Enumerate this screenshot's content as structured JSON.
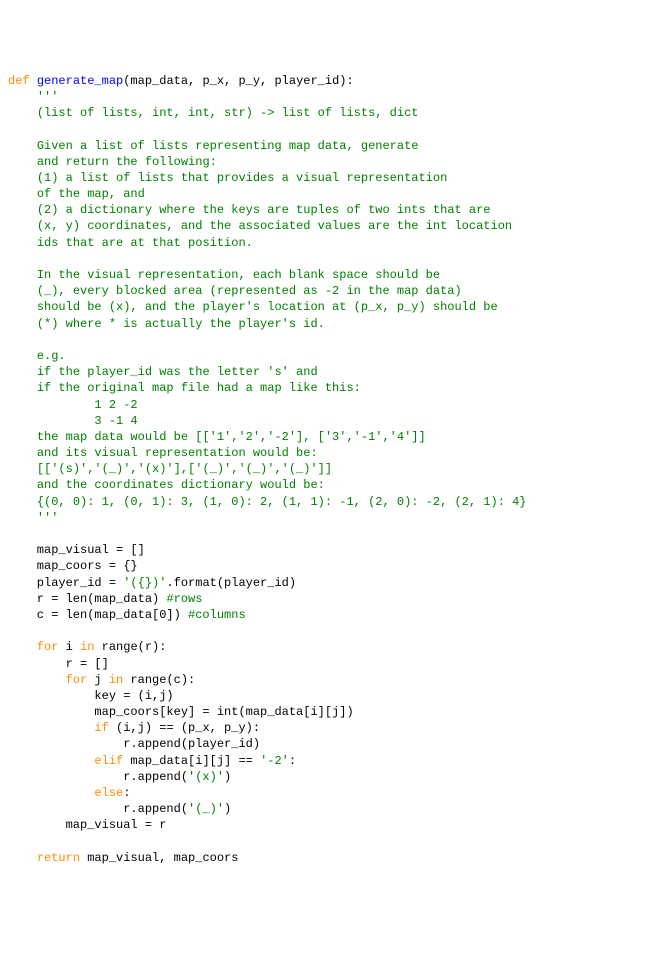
{
  "code": {
    "lines": [
      {
        "parts": [
          {
            "cls": "kw",
            "t": "def "
          },
          {
            "cls": "fn",
            "t": "generate_map"
          },
          {
            "cls": "",
            "t": "(map_data, p_x, p_y, player_id):"
          }
        ]
      },
      {
        "parts": [
          {
            "cls": "",
            "t": "    "
          },
          {
            "cls": "s",
            "t": "'''"
          }
        ]
      },
      {
        "parts": [
          {
            "cls": "",
            "t": "    "
          },
          {
            "cls": "s",
            "t": "(list of lists, int, int, str) -> list of lists, dict"
          }
        ]
      },
      {
        "parts": [
          {
            "cls": "s",
            "t": ""
          }
        ]
      },
      {
        "parts": [
          {
            "cls": "",
            "t": "    "
          },
          {
            "cls": "s",
            "t": "Given a list of lists representing map data, generate"
          }
        ]
      },
      {
        "parts": [
          {
            "cls": "",
            "t": "    "
          },
          {
            "cls": "s",
            "t": "and return the following:"
          }
        ]
      },
      {
        "parts": [
          {
            "cls": "",
            "t": "    "
          },
          {
            "cls": "s",
            "t": "(1) a list of lists that provides a visual representation"
          }
        ]
      },
      {
        "parts": [
          {
            "cls": "",
            "t": "    "
          },
          {
            "cls": "s",
            "t": "of the map, and"
          }
        ]
      },
      {
        "parts": [
          {
            "cls": "",
            "t": "    "
          },
          {
            "cls": "s",
            "t": "(2) a dictionary where the keys are tuples of two ints that are"
          }
        ]
      },
      {
        "parts": [
          {
            "cls": "",
            "t": "    "
          },
          {
            "cls": "s",
            "t": "(x, y) coordinates, and the associated values are the int location"
          }
        ]
      },
      {
        "parts": [
          {
            "cls": "",
            "t": "    "
          },
          {
            "cls": "s",
            "t": "ids that are at that position."
          }
        ]
      },
      {
        "parts": [
          {
            "cls": "s",
            "t": ""
          }
        ]
      },
      {
        "parts": [
          {
            "cls": "",
            "t": "    "
          },
          {
            "cls": "s",
            "t": "In the visual representation, each blank space should be"
          }
        ]
      },
      {
        "parts": [
          {
            "cls": "",
            "t": "    "
          },
          {
            "cls": "s",
            "t": "(_), every blocked area (represented as -2 in the map data)"
          }
        ]
      },
      {
        "parts": [
          {
            "cls": "",
            "t": "    "
          },
          {
            "cls": "s",
            "t": "should be (x), and the player's location at (p_x, p_y) should be"
          }
        ]
      },
      {
        "parts": [
          {
            "cls": "",
            "t": "    "
          },
          {
            "cls": "s",
            "t": "(*) where * is actually the player's id."
          }
        ]
      },
      {
        "parts": [
          {
            "cls": "s",
            "t": ""
          }
        ]
      },
      {
        "parts": [
          {
            "cls": "",
            "t": "    "
          },
          {
            "cls": "s",
            "t": "e.g."
          }
        ]
      },
      {
        "parts": [
          {
            "cls": "",
            "t": "    "
          },
          {
            "cls": "s",
            "t": "if the player_id was the letter 's' and"
          }
        ]
      },
      {
        "parts": [
          {
            "cls": "",
            "t": "    "
          },
          {
            "cls": "s",
            "t": "if the original map file had a map like this:"
          }
        ]
      },
      {
        "parts": [
          {
            "cls": "",
            "t": "    "
          },
          {
            "cls": "s",
            "t": "        1 2 -2"
          }
        ]
      },
      {
        "parts": [
          {
            "cls": "",
            "t": "    "
          },
          {
            "cls": "s",
            "t": "        3 -1 4"
          }
        ]
      },
      {
        "parts": [
          {
            "cls": "",
            "t": "    "
          },
          {
            "cls": "s",
            "t": "the map data would be [['1','2','-2'], ['3','-1','4']]"
          }
        ]
      },
      {
        "parts": [
          {
            "cls": "",
            "t": "    "
          },
          {
            "cls": "s",
            "t": "and its visual representation would be:"
          }
        ]
      },
      {
        "parts": [
          {
            "cls": "",
            "t": "    "
          },
          {
            "cls": "s",
            "t": "[['(s)','(_)','(x)'],['(_)','(_)','(_)']]"
          }
        ]
      },
      {
        "parts": [
          {
            "cls": "",
            "t": "    "
          },
          {
            "cls": "s",
            "t": "and the coordinates dictionary would be:"
          }
        ]
      },
      {
        "parts": [
          {
            "cls": "",
            "t": "    "
          },
          {
            "cls": "s",
            "t": "{(0, 0): 1, (0, 1): 3, (1, 0): 2, (1, 1): -1, (2, 0): -2, (2, 1): 4}"
          }
        ]
      },
      {
        "parts": [
          {
            "cls": "",
            "t": "    "
          },
          {
            "cls": "s",
            "t": "'''"
          }
        ]
      },
      {
        "parts": [
          {
            "cls": "",
            "t": ""
          }
        ]
      },
      {
        "parts": [
          {
            "cls": "",
            "t": "    map_visual = []"
          }
        ]
      },
      {
        "parts": [
          {
            "cls": "",
            "t": "    map_coors = {}"
          }
        ]
      },
      {
        "parts": [
          {
            "cls": "",
            "t": "    player_id = "
          },
          {
            "cls": "s",
            "t": "'({})'"
          },
          {
            "cls": "",
            "t": ".format(player_id)"
          }
        ]
      },
      {
        "parts": [
          {
            "cls": "",
            "t": "    r = len(map_data) "
          },
          {
            "cls": "s",
            "t": "#rows"
          }
        ]
      },
      {
        "parts": [
          {
            "cls": "",
            "t": "    c = len(map_data[0]) "
          },
          {
            "cls": "s",
            "t": "#columns"
          }
        ]
      },
      {
        "parts": [
          {
            "cls": "",
            "t": ""
          }
        ]
      },
      {
        "parts": [
          {
            "cls": "",
            "t": "    "
          },
          {
            "cls": "kw",
            "t": "for"
          },
          {
            "cls": "",
            "t": " i "
          },
          {
            "cls": "kw",
            "t": "in"
          },
          {
            "cls": "",
            "t": " range(r):"
          }
        ]
      },
      {
        "parts": [
          {
            "cls": "",
            "t": "        r = []"
          }
        ]
      },
      {
        "parts": [
          {
            "cls": "",
            "t": "        "
          },
          {
            "cls": "kw",
            "t": "for"
          },
          {
            "cls": "",
            "t": " j "
          },
          {
            "cls": "kw",
            "t": "in"
          },
          {
            "cls": "",
            "t": " range(c):"
          }
        ]
      },
      {
        "parts": [
          {
            "cls": "",
            "t": "            key = (i,j)"
          }
        ]
      },
      {
        "parts": [
          {
            "cls": "",
            "t": "            map_coors[key] = int(map_data[i][j])"
          }
        ]
      },
      {
        "parts": [
          {
            "cls": "",
            "t": "            "
          },
          {
            "cls": "kw",
            "t": "if"
          },
          {
            "cls": "",
            "t": " (i,j) == (p_x, p_y):"
          }
        ]
      },
      {
        "parts": [
          {
            "cls": "",
            "t": "                r.append(player_id)"
          }
        ]
      },
      {
        "parts": [
          {
            "cls": "",
            "t": "            "
          },
          {
            "cls": "kw",
            "t": "elif"
          },
          {
            "cls": "",
            "t": " map_data[i][j] == "
          },
          {
            "cls": "s",
            "t": "'-2'"
          },
          {
            "cls": "",
            "t": ":"
          }
        ]
      },
      {
        "parts": [
          {
            "cls": "",
            "t": "                r.append("
          },
          {
            "cls": "s",
            "t": "'(x)'"
          },
          {
            "cls": "",
            "t": ")"
          }
        ]
      },
      {
        "parts": [
          {
            "cls": "",
            "t": "            "
          },
          {
            "cls": "kw",
            "t": "else"
          },
          {
            "cls": "",
            "t": ":"
          }
        ]
      },
      {
        "parts": [
          {
            "cls": "",
            "t": "                r.append("
          },
          {
            "cls": "s",
            "t": "'(_)'"
          },
          {
            "cls": "",
            "t": ")"
          }
        ]
      },
      {
        "parts": [
          {
            "cls": "",
            "t": "        map_visual = r"
          }
        ]
      },
      {
        "parts": [
          {
            "cls": "",
            "t": ""
          }
        ]
      },
      {
        "parts": [
          {
            "cls": "",
            "t": "    "
          },
          {
            "cls": "kw",
            "t": "return"
          },
          {
            "cls": "",
            "t": " map_visual, map_coors"
          }
        ]
      }
    ]
  }
}
